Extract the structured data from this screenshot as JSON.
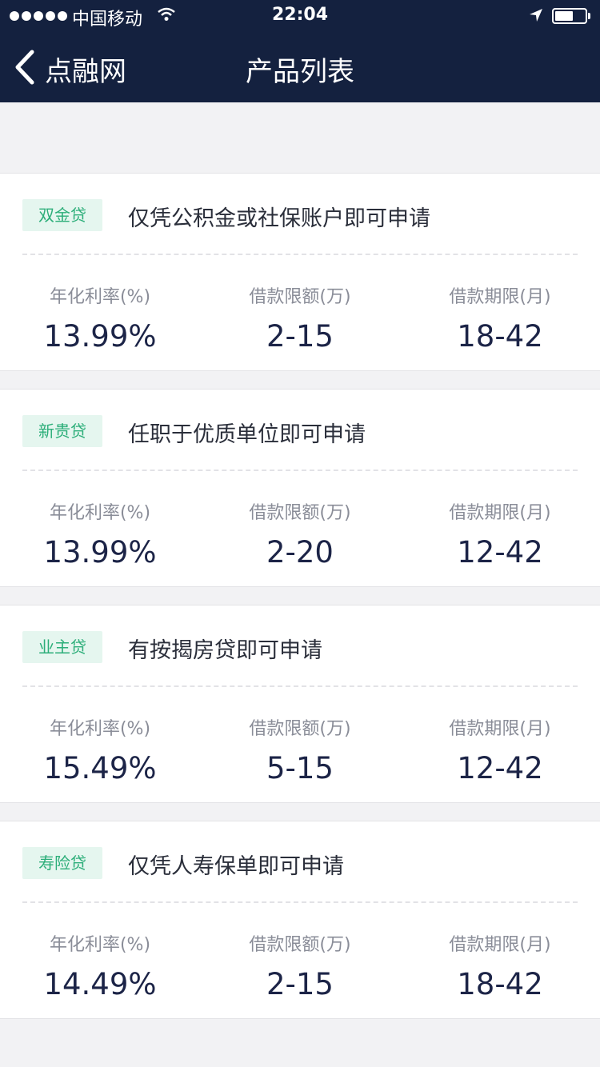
{
  "status_bar": {
    "carrier": "中国移动",
    "time": "22:04"
  },
  "nav": {
    "back_label": "点融网",
    "title": "产品列表"
  },
  "labels": {
    "rate": "年化利率(%)",
    "amount": "借款限额(万)",
    "term": "借款期限(月)"
  },
  "products": [
    {
      "tag": "双金贷",
      "desc": "仅凭公积金或社保账户即可申请",
      "rate": "13.99%",
      "amount": "2-15",
      "term": "18-42"
    },
    {
      "tag": "新贵贷",
      "desc": "任职于优质单位即可申请",
      "rate": "13.99%",
      "amount": "2-20",
      "term": "12-42"
    },
    {
      "tag": "业主贷",
      "desc": "有按揭房贷即可申请",
      "rate": "15.49%",
      "amount": "5-15",
      "term": "12-42"
    },
    {
      "tag": "寿险贷",
      "desc": "仅凭人寿保单即可申请",
      "rate": "14.49%",
      "amount": "2-15",
      "term": "18-42"
    }
  ],
  "colors": {
    "header_bg": "#14213f",
    "tag_bg": "#e5f6ef",
    "tag_text": "#2cae79",
    "value_text": "#1c2447"
  }
}
